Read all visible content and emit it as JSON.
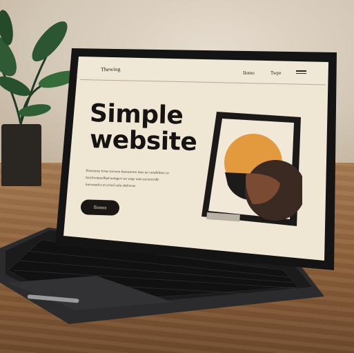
{
  "site": {
    "brand": "Thewiog",
    "nav": {
      "link1": "Ilomo",
      "link2": "Twpe"
    },
    "headline_line1": "Simple",
    "headline_line2": "website",
    "body_text": "Ilvenstons lorue torrenn buenstoreu lans ao vsoahtlane ca luvslrcotuoelkad uomgerr ao wrge oum uersiocrdle loevsoaelcs en yruol eulu ekdrnrue",
    "cta_label": "Ilomra"
  },
  "colors": {
    "screen_bg": "#efe6d4",
    "accent_orange": "#e39a3f",
    "dark_circle": "#3a2a22",
    "brown_overlap": "#7a4a32",
    "bezel": "#141414"
  },
  "icons": {
    "menu": "hamburger-menu-icon"
  }
}
